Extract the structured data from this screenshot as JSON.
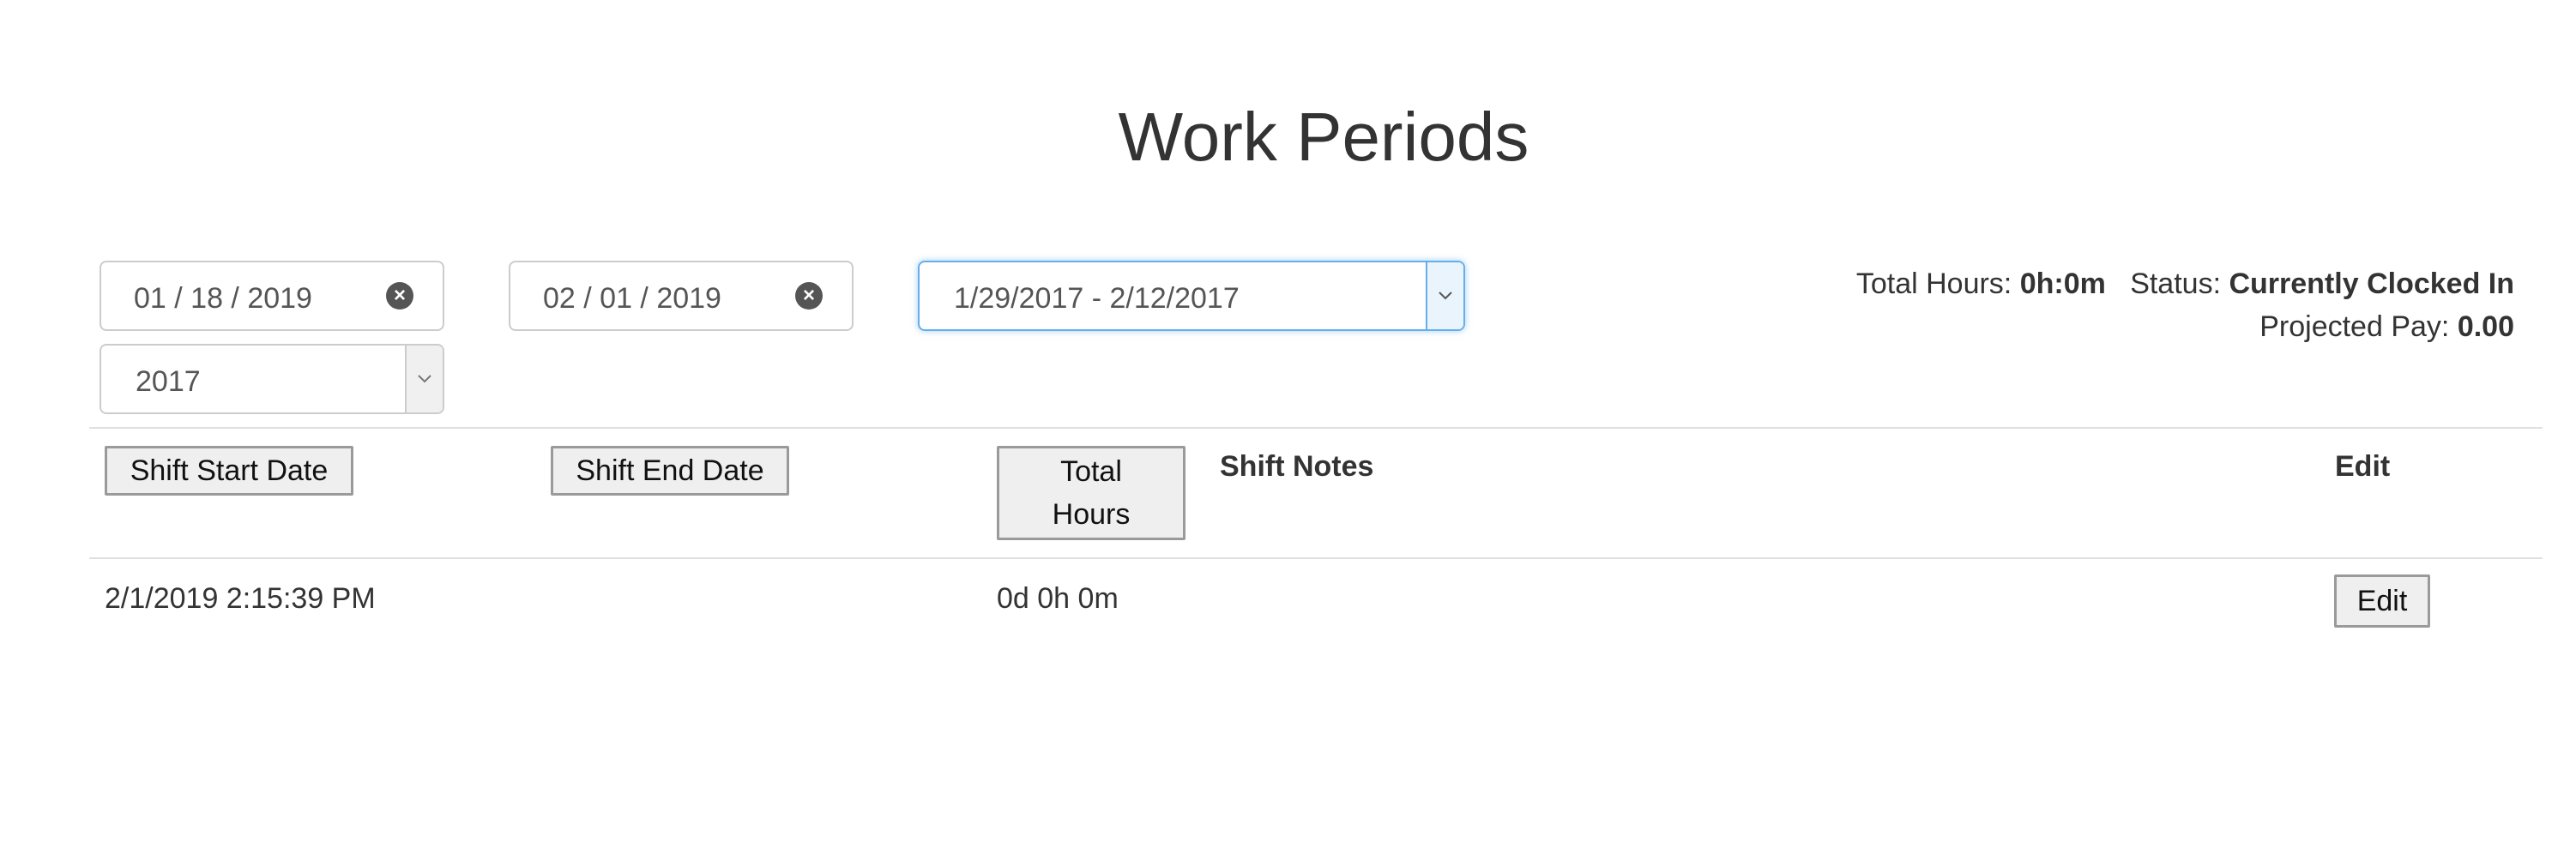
{
  "page": {
    "title": "Work Periods"
  },
  "filters": {
    "start_date": "01 / 18 / 2019",
    "end_date": "02 / 01 / 2019",
    "period": "1/29/2017 - 2/12/2017",
    "year": "2017"
  },
  "summary": {
    "total_hours_label": "Total Hours:",
    "total_hours_value": "0h:0m",
    "status_label": "Status:",
    "status_value": "Currently Clocked In",
    "projected_pay_label": "Projected Pay:",
    "projected_pay_value": "0.00"
  },
  "table": {
    "headers": {
      "shift_start": "Shift Start Date",
      "shift_end": "Shift End Date",
      "total_hours_line1": "Total",
      "total_hours_line2": "Hours",
      "shift_notes": "Shift Notes",
      "edit": "Edit"
    },
    "rows": [
      {
        "shift_start": "2/1/2019 2:15:39 PM",
        "shift_end": "",
        "total_hours": "0d 0h 0m",
        "shift_notes": "",
        "edit_label": "Edit"
      }
    ]
  },
  "icons": {
    "clear": "clear-circle-icon",
    "dropdown": "chevron-down-icon"
  },
  "colors": {
    "focus_border": "#66afe9",
    "text": "#333333"
  }
}
